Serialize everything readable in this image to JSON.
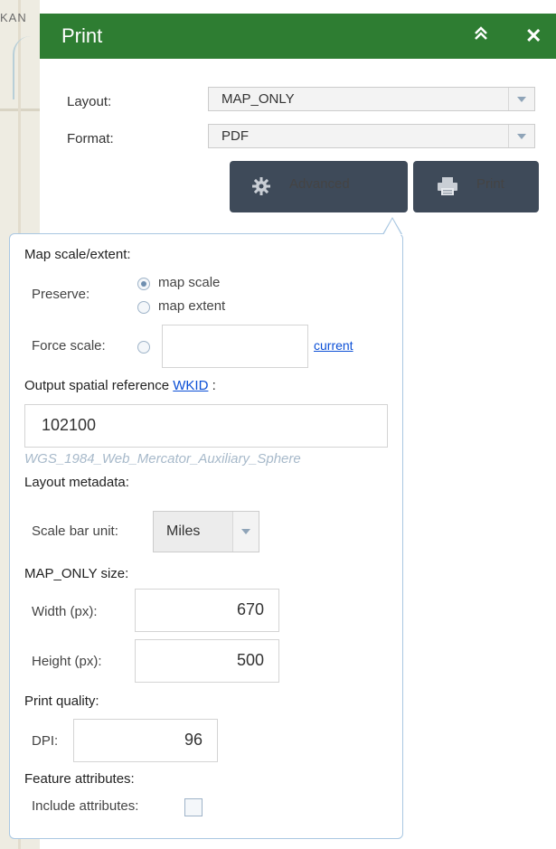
{
  "map": {
    "label": "KAN"
  },
  "header": {
    "title": "Print",
    "collapse_icon": "double-chevron-up-icon",
    "close_icon": "close-icon",
    "color": "#2e7d32"
  },
  "form": {
    "layout_label": "Layout:",
    "layout_value": "MAP_ONLY",
    "format_label": "Format:",
    "format_value": "PDF"
  },
  "buttons": {
    "advanced_label": "Advanced",
    "advanced_icon": "gear-icon",
    "print_label": "Print",
    "print_icon": "printer-icon"
  },
  "advanced": {
    "scale_title": "Map scale/extent:",
    "preserve_label": "Preserve:",
    "map_scale_label": "map scale",
    "map_extent_label": "map extent",
    "force_scale_label": "Force scale:",
    "force_scale_value": "",
    "current_link": "current",
    "srs_title_prefix": "Output spatial reference",
    "srs_link": "WKID",
    "srs_suffix": ":",
    "wkid_value": "102100",
    "wkid_name": "WGS_1984_Web_Mercator_Auxiliary_Sphere",
    "layout_meta_title": "Layout metadata:",
    "scale_bar_label": "Scale bar unit:",
    "scale_bar_value": "Miles",
    "size_title": "MAP_ONLY size:",
    "width_label": "Width (px):",
    "width_value": "670",
    "height_label": "Height (px):",
    "height_value": "500",
    "quality_title": "Print quality:",
    "dpi_label": "DPI:",
    "dpi_value": "96",
    "feature_title": "Feature attributes:",
    "include_label": "Include attributes:"
  }
}
